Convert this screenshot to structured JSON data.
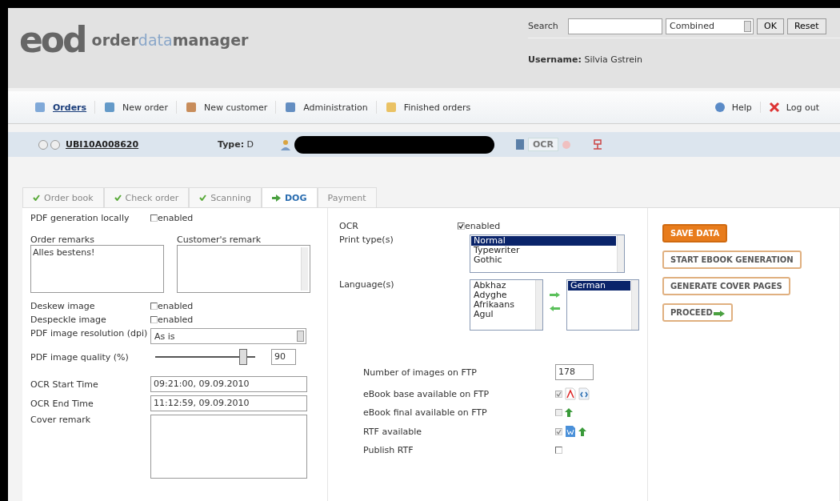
{
  "logo": {
    "mark": "eod",
    "brand": "**order**data**manager**"
  },
  "search": {
    "label": "Search",
    "mode": "Combined",
    "buttons": [
      "OK",
      "Reset"
    ]
  },
  "user": {
    "label": "Username:",
    "name": "Silvia Gstrein"
  },
  "nav": {
    "items": [
      {
        "label": "Orders",
        "selected": true
      },
      {
        "label": "New order",
        "selected": false
      },
      {
        "label": "New customer",
        "selected": false
      },
      {
        "label": "Administration",
        "selected": false
      },
      {
        "label": "Finished orders",
        "selected": false
      }
    ],
    "right": [
      {
        "label": "Help"
      },
      {
        "label": "Log out"
      }
    ]
  },
  "order": {
    "id": "UBI10A008620",
    "type_label": "Type:",
    "type": "D",
    "ocr": "OCR"
  },
  "tabs": [
    {
      "label": "Order book",
      "done": true,
      "selected": false
    },
    {
      "label": "Check order",
      "done": true,
      "selected": false
    },
    {
      "label": "Scanning",
      "done": true,
      "selected": false
    },
    {
      "label": "DOG",
      "done": false,
      "selected": true
    },
    {
      "label": "Payment",
      "done": false,
      "selected": false
    }
  ],
  "left": {
    "pdf_local": {
      "label": "PDF generation locally",
      "option": "enabled",
      "checked": false
    },
    "order_remarks": {
      "label": "Order remarks",
      "value": "Alles bestens!"
    },
    "customer_remark": {
      "label": "Customer's remark"
    },
    "deskew": {
      "label": "Deskew image",
      "option": "enabled",
      "checked": false
    },
    "despeckle": {
      "label": "Despeckle image",
      "option": "enabled",
      "checked": false
    },
    "resolution": {
      "label": "PDF image resolution (dpi)",
      "value": "As is"
    },
    "quality": {
      "label": "PDF image quality (%)",
      "level": 0.9,
      "value": "90"
    },
    "ocr_start": {
      "label": "OCR Start Time",
      "value": "09:21:00, 09.09.2010"
    },
    "ocr_end": {
      "label": "OCR End Time",
      "value": "11:12:59, 09.09.2010"
    },
    "cover": {
      "label": "Cover remark"
    }
  },
  "middle": {
    "ocr": {
      "label": "OCR",
      "option": "enabled",
      "checked": true
    },
    "print_types": {
      "label": "Print type(s)",
      "options": [
        {
          "label": "Normal",
          "selected": true
        },
        {
          "label": "Typewriter",
          "selected": false
        },
        {
          "label": "Gothic",
          "selected": false
        }
      ]
    },
    "languages": {
      "label": "Language(s)",
      "available": [
        {
          "label": "Abkhaz",
          "selected": false
        },
        {
          "label": "Adyghe",
          "selected": false
        },
        {
          "label": "Afrikaans",
          "selected": false
        },
        {
          "label": "Agul",
          "selected": false
        }
      ],
      "chosen": [
        {
          "label": "German",
          "selected": true
        }
      ]
    },
    "ftp": [
      {
        "label": "Number of images on FTP",
        "kind": "input",
        "value": "178"
      },
      {
        "label": "eBook base available on FTP",
        "kind": "check",
        "checked": true,
        "disabled": true
      },
      {
        "label": "eBook final available on FTP",
        "kind": "check",
        "checked": false,
        "disabled": true
      },
      {
        "label": "RTF available",
        "kind": "check",
        "checked": true,
        "disabled": true
      },
      {
        "label": "Publish RTF",
        "kind": "check",
        "checked": false,
        "disabled": false
      }
    ]
  },
  "actions": [
    {
      "label": "SAVE DATA",
      "kind": "primary"
    },
    {
      "label": "START EBOOK GENERATION",
      "kind": "plain"
    },
    {
      "label": "GENERATE COVER PAGES",
      "kind": "plain"
    },
    {
      "label": "PROCEED",
      "kind": "next"
    }
  ]
}
